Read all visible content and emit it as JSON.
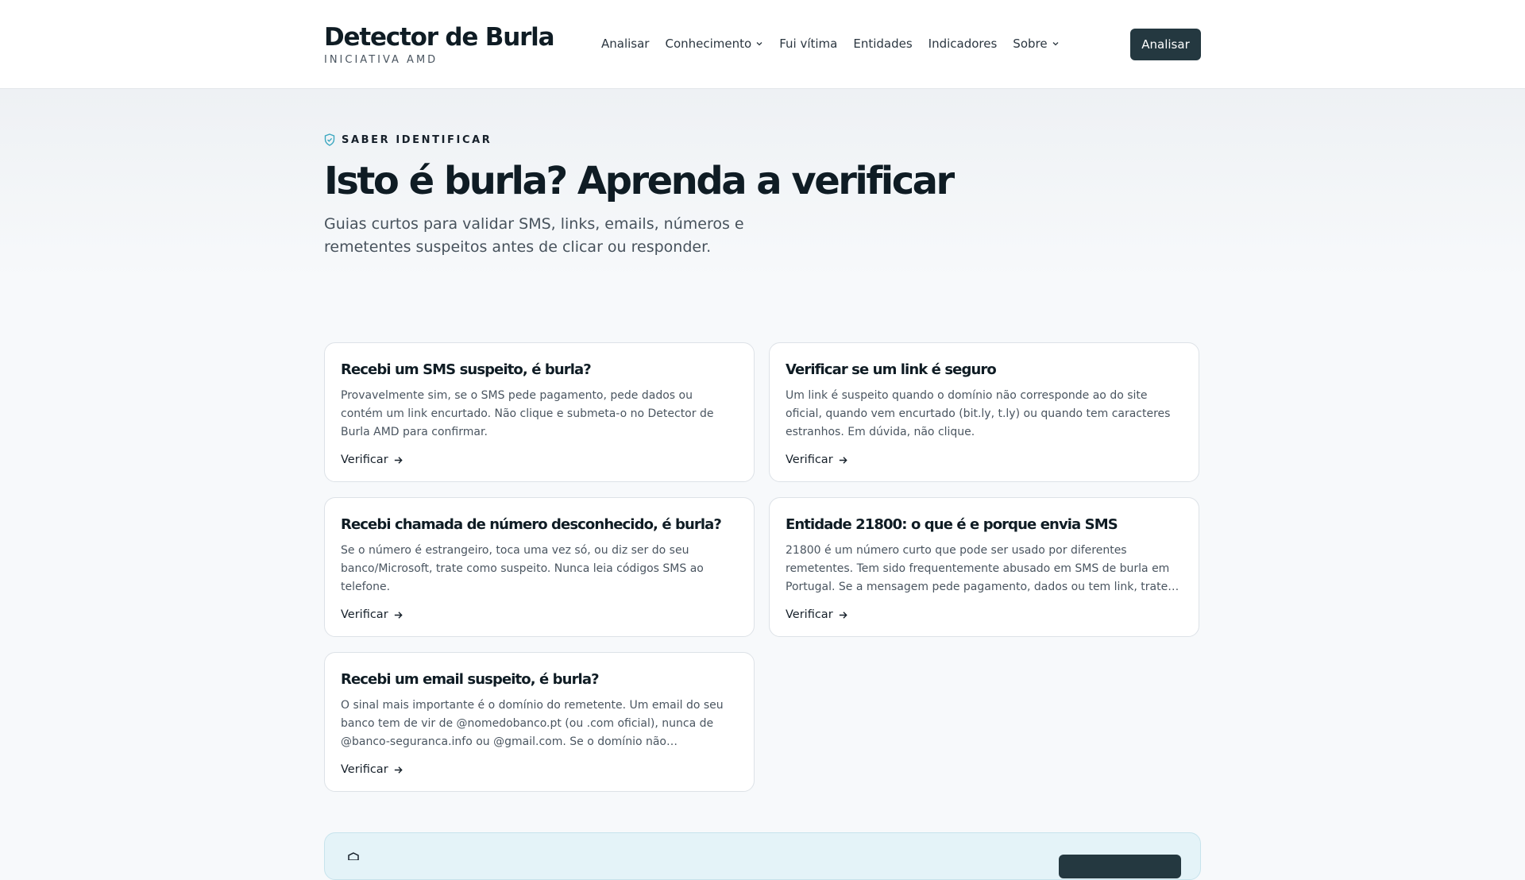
{
  "header": {
    "brand_title": "Detector de Burla",
    "brand_subtitle": "INICIATIVA AMD",
    "nav": [
      {
        "label": "Analisar",
        "dropdown": false
      },
      {
        "label": "Conhecimento",
        "dropdown": true
      },
      {
        "label": "Fui vítima",
        "dropdown": false
      },
      {
        "label": "Entidades",
        "dropdown": false
      },
      {
        "label": "Indicadores",
        "dropdown": false
      },
      {
        "label": "Sobre",
        "dropdown": true
      }
    ],
    "cta_label": "Analisar"
  },
  "hero": {
    "eyebrow": "SABER IDENTIFICAR",
    "title": "Isto é burla? Aprenda a verificar",
    "lead": "Guias curtos para validar SMS, links, emails, números e remetentes suspeitos antes de clicar ou responder."
  },
  "cards": [
    {
      "title": "Recebi um SMS suspeito, é burla?",
      "text": "Provavelmente sim, se o SMS pede pagamento, pede dados ou contém um link encurtado. Não clique e submeta-o no Detector de Burla AMD para confirmar.",
      "link": "Verificar"
    },
    {
      "title": "Verificar se um link é seguro",
      "text": "Um link é suspeito quando o domínio não corresponde ao do site oficial, quando vem encurtado (bit.ly, t.ly) ou quando tem caracteres estranhos. Em dúvida, não clique.",
      "link": "Verificar"
    },
    {
      "title": "Recebi chamada de número desconhecido, é burla?",
      "text": "Se o número é estrangeiro, toca uma vez só, ou diz ser do seu banco/Microsoft, trate como suspeito. Nunca leia códigos SMS ao telefone.",
      "link": "Verificar"
    },
    {
      "title": "Entidade 21800: o que é e porque envia SMS",
      "text": "21800 é um número curto que pode ser usado por diferentes remetentes. Tem sido frequentemente abusado em SMS de burla em Portugal. Se a mensagem pede pagamento, dados ou tem link, trate…",
      "link": "Verificar"
    },
    {
      "title": "Recebi um email suspeito, é burla?",
      "text": "O sinal mais importante é o domínio do remetente. Um email do seu banco tem de vir de @nomedobanco.pt (ou .com oficial), nunca de @banco-seguranca.info ou @gmail.com. Se o domínio não…",
      "link": "Verificar"
    }
  ],
  "colors": {
    "accent_dark": "#243840",
    "eyebrow_icon": "#3aa7c0",
    "banner_bg": "#e4f3f8"
  }
}
